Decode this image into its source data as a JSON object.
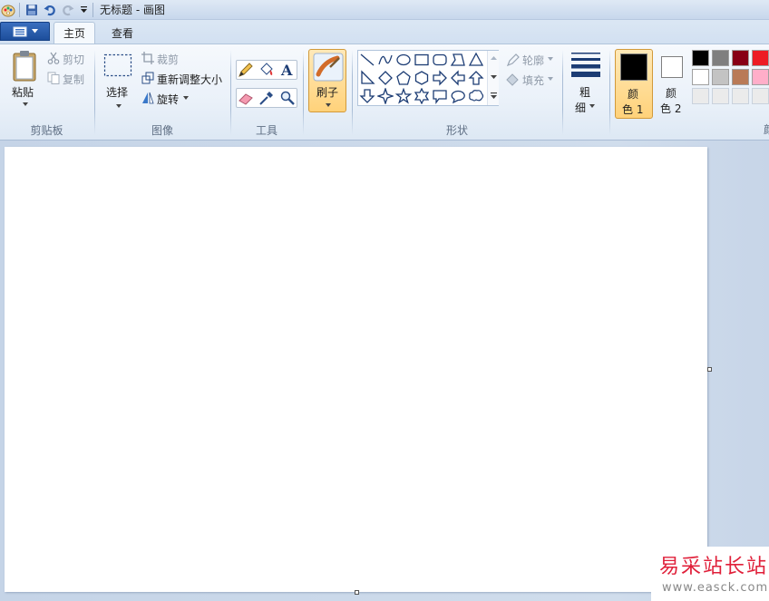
{
  "window": {
    "title": "无标题 - 画图"
  },
  "tabs": {
    "home": "主页",
    "view": "查看"
  },
  "clipboard": {
    "paste": "粘贴",
    "cut": "剪切",
    "copy": "复制",
    "group": "剪贴板"
  },
  "image": {
    "select": "选择",
    "crop": "裁剪",
    "resize": "重新调整大小",
    "rotate": "旋转",
    "group": "图像"
  },
  "tools": {
    "group": "工具"
  },
  "brush": {
    "label": "刷子"
  },
  "shapes": {
    "outline": "轮廓",
    "fill": "填充",
    "group": "形状"
  },
  "size": {
    "line1": "粗",
    "line2": "细"
  },
  "colors": {
    "color1_line1": "颜",
    "color1_line2": "色 1",
    "color2_line1": "颜",
    "color2_line2": "色 2",
    "group": "颜",
    "color1_value": "#000000",
    "color2_value": "#ffffff",
    "palette": [
      "#000000",
      "#7f7f7f",
      "#880015",
      "#ed1c24",
      "#ffffff",
      "#c3c3c3",
      "#b97a57",
      "#ffaec9",
      "#ebebeb",
      "#ebebeb",
      "#ebebeb",
      "#ebebeb"
    ]
  },
  "watermark": {
    "name": "易采站长站",
    "url": "www.easck.com"
  }
}
